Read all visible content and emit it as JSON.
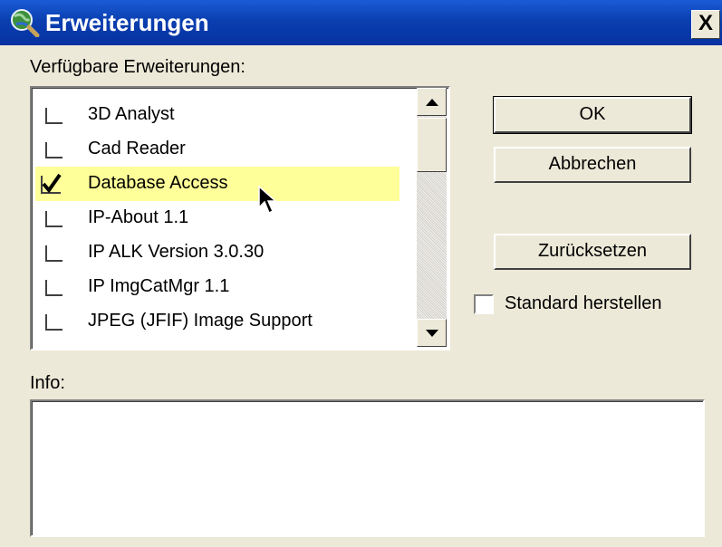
{
  "window": {
    "title": "Erweiterungen",
    "close_label": "X"
  },
  "labels": {
    "available": "Verfügbare Erweiterungen:",
    "info": "Info:"
  },
  "extensions": [
    {
      "label": "3D Analyst",
      "checked": false
    },
    {
      "label": "Cad Reader",
      "checked": false
    },
    {
      "label": "Database Access",
      "checked": true,
      "highlighted": true
    },
    {
      "label": "IP-About 1.1",
      "checked": false
    },
    {
      "label": "IP ALK Version 3.0.30",
      "checked": false
    },
    {
      "label": "IP ImgCatMgr 1.1",
      "checked": false
    },
    {
      "label": "JPEG (JFIF) Image Support",
      "checked": false
    }
  ],
  "buttons": {
    "ok": "OK",
    "cancel": "Abbrechen",
    "reset": "Zurücksetzen"
  },
  "restore_default": {
    "label": "Standard herstellen",
    "checked": false
  },
  "info_text": "",
  "colors": {
    "title_bar": "#0a3fb0",
    "highlight": "#ffff99",
    "dialog_bg": "#ece9d8"
  }
}
